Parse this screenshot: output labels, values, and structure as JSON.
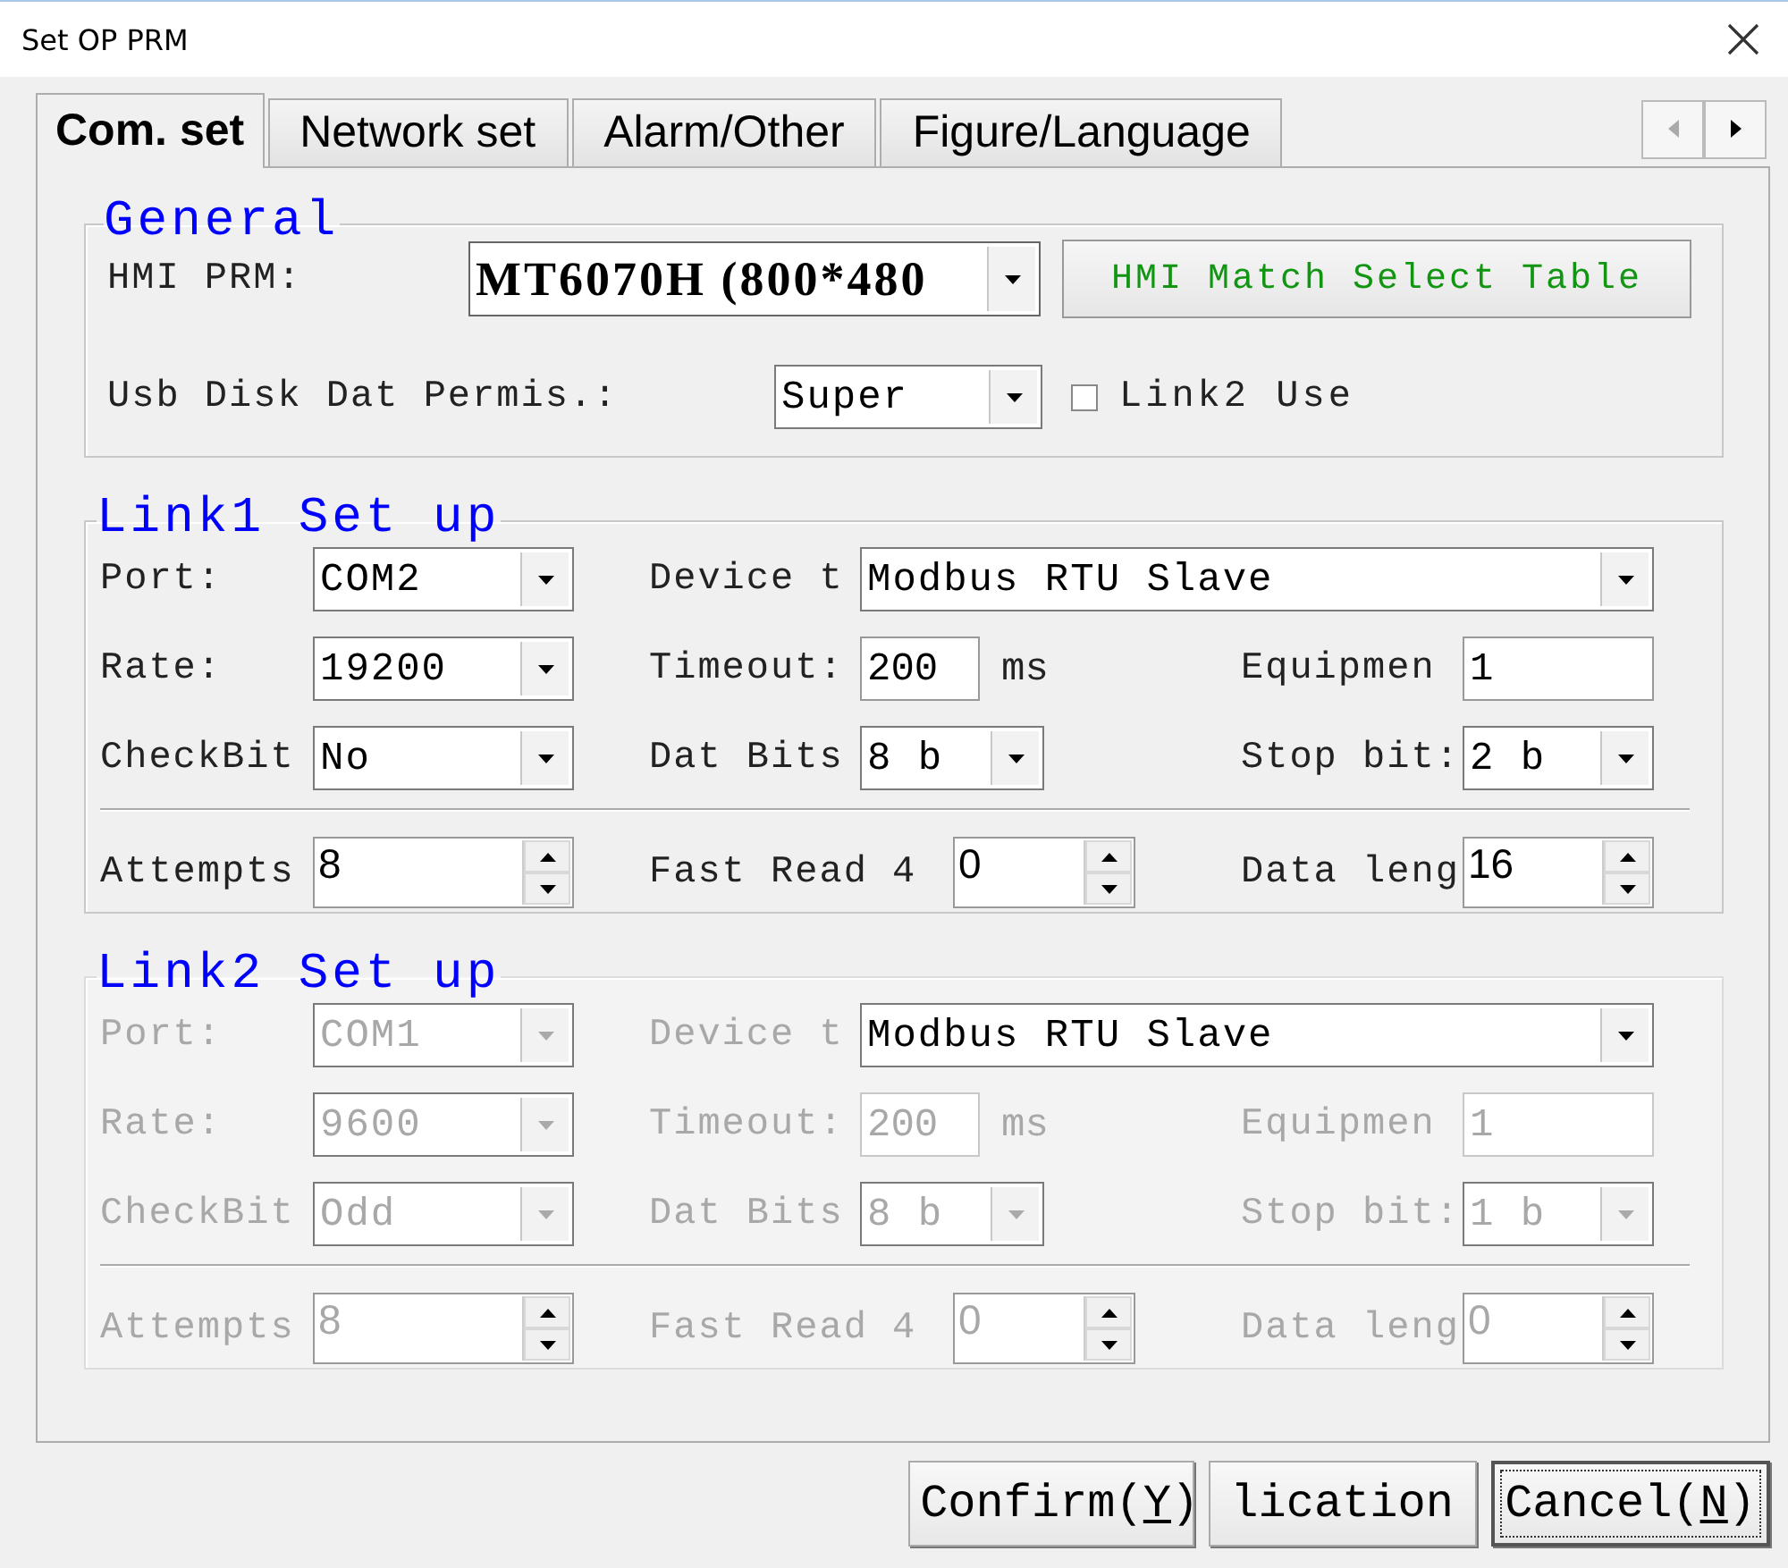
{
  "window": {
    "title": "Set OP PRM"
  },
  "tabs": [
    {
      "label": "Com. set",
      "selected": true
    },
    {
      "label": "Network set",
      "selected": false
    },
    {
      "label": "Alarm/Other",
      "selected": false
    },
    {
      "label": "Figure/Language",
      "selected": false
    }
  ],
  "tab_scroll": {
    "left_disabled": true,
    "right_disabled": false
  },
  "general": {
    "title": "General",
    "hmi_prm": {
      "label": "HMI PRM:",
      "value": "MT6070H (800*480"
    },
    "match_button": "HMI Match Select Table",
    "usb": {
      "label": "Usb Disk Dat Permis.:",
      "value": "Super"
    },
    "link2_use": {
      "label": "Link2 Use",
      "checked": false
    }
  },
  "links": [
    {
      "title": "Link1 Set up",
      "disabled": false,
      "rows": [
        [
          {
            "kind": "combo",
            "label": "Port:",
            "value": "COM2",
            "disabled": false
          },
          {
            "kind": "combo",
            "label": "Device t",
            "value": "Modbus RTU Slave",
            "disabled": false
          }
        ],
        [
          {
            "kind": "combo",
            "label": "Rate:",
            "value": "19200",
            "disabled": false
          },
          {
            "kind": "text",
            "label": "Timeout:",
            "value": "200",
            "unit": "ms",
            "disabled": false
          },
          {
            "kind": "text",
            "label": "Equipmen",
            "value": "1",
            "disabled": false
          }
        ],
        [
          {
            "kind": "combo",
            "label": "CheckBit",
            "value": "No",
            "disabled": false
          },
          {
            "kind": "combo",
            "label": "Dat Bits",
            "value": "8 b",
            "disabled": false
          },
          {
            "kind": "combo",
            "label": "Stop bit:",
            "value": "2 b",
            "disabled": false
          }
        ]
      ],
      "spin_row": [
        {
          "kind": "spin",
          "label": "Attempts",
          "value": "8",
          "disabled": false
        },
        {
          "kind": "spin",
          "label": "Fast Read 4",
          "value": "0",
          "disabled": false
        },
        {
          "kind": "spin",
          "label": "Data leng",
          "value": "16",
          "disabled": false
        }
      ]
    },
    {
      "title": "Link2 Set up",
      "disabled": true,
      "rows": [
        [
          {
            "kind": "combo",
            "label": "Port:",
            "value": "COM1",
            "disabled": true
          },
          {
            "kind": "combo",
            "label": "Device t",
            "value": "Modbus RTU Slave",
            "disabled": false
          }
        ],
        [
          {
            "kind": "combo",
            "label": "Rate:",
            "value": "9600",
            "disabled": true
          },
          {
            "kind": "text",
            "label": "Timeout:",
            "value": "200",
            "unit": "ms",
            "disabled": true
          },
          {
            "kind": "text",
            "label": "Equipmen",
            "value": "1",
            "disabled": true
          }
        ],
        [
          {
            "kind": "combo",
            "label": "CheckBit",
            "value": "Odd",
            "disabled": true
          },
          {
            "kind": "combo",
            "label": "Dat Bits",
            "value": "8 b",
            "disabled": true
          },
          {
            "kind": "combo",
            "label": "Stop bit:",
            "value": "1 b",
            "disabled": true
          }
        ]
      ],
      "spin_row": [
        {
          "kind": "spin",
          "label": "Attempts",
          "value": "8",
          "disabled": true
        },
        {
          "kind": "spin",
          "label": "Fast Read 4",
          "value": "0",
          "disabled": true
        },
        {
          "kind": "spin",
          "label": "Data leng",
          "value": "0",
          "disabled": true
        }
      ]
    }
  ],
  "buttons": [
    {
      "text": "Confirm(",
      "hotkey": "Y",
      "after": ")",
      "focused": false
    },
    {
      "text": "lication",
      "focused": false
    },
    {
      "text": "Cancel(",
      "hotkey": "N",
      "after": ")",
      "focused": true
    }
  ]
}
